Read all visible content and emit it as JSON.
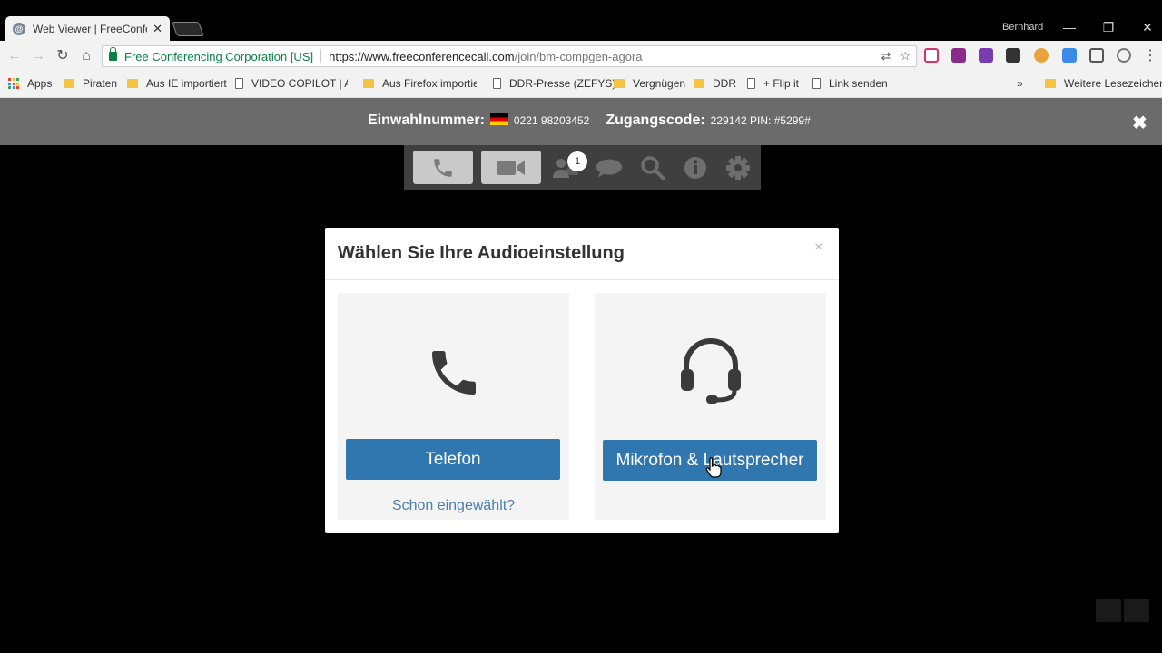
{
  "browser": {
    "tab_title": "Web Viewer | FreeConfere",
    "profile_name": "Bernhard",
    "org_name": "Free Conferencing Corporation [US]",
    "url_host": "https://www.freeconferencecall.com",
    "url_path": "/join/bm-compgen-agora",
    "bookmarks": [
      "Apps",
      "Piraten",
      "Aus IE importiert",
      "VIDEO COPILOT | Afte",
      "Aus Firefox importier",
      "DDR-Presse (ZEFYS)",
      "Vergnügen",
      "DDR",
      "+ Flip it",
      "Link senden"
    ],
    "more_bookmarks": "Weitere Lesezeichen"
  },
  "dialbar": {
    "dialin_label": "Einwahlnummer:",
    "dialin_number": "0221 98203452",
    "access_label": "Zugangscode:",
    "access_value": "229142 PIN: #5299#"
  },
  "controls": {
    "participants_count": "1",
    "icons": [
      "phone-icon",
      "video-icon",
      "participants-icon",
      "chat-icon",
      "search-icon",
      "info-icon",
      "settings-icon"
    ]
  },
  "modal": {
    "title": "Wählen Sie Ihre Audioeinstellung",
    "close": "×",
    "phone_button": "Telefon",
    "already_dialed": "Schon eingewählt?",
    "mic_button": "Mikrofon & Lautsprecher"
  },
  "colors": {
    "accent_button": "#2f77ae",
    "dialbar": "#6b6b6b",
    "controls_bar": "#3f3f3f"
  }
}
